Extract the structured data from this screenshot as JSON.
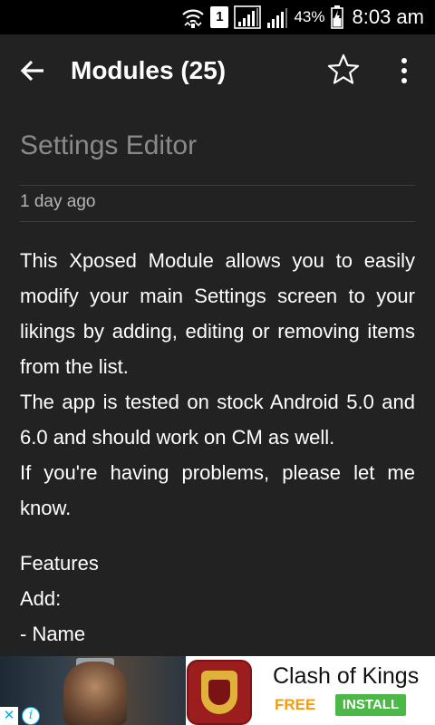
{
  "status_bar": {
    "sim_slot": "1",
    "battery_percent": "43%",
    "time": "8:03 am",
    "icons": [
      "wifi-icon",
      "sim-icon",
      "signal-icon",
      "signal-icon",
      "battery-icon"
    ]
  },
  "toolbar": {
    "title": "Modules (25)",
    "icons": [
      "back-arrow-icon",
      "star-outline-icon",
      "more-vert-icon"
    ]
  },
  "module": {
    "name": "Settings Editor",
    "updated": "1 day ago",
    "description": [
      "This Xposed Module allows you to easily modify your main Settings screen to your likings by adding, editing or removing items from the list.",
      "The app is tested on stock Android 5.0 and 6.0 and should work on CM as well.",
      "If you're having problems, please let me know."
    ],
    "features_heading": "Features",
    "features_add": "Add:",
    "features_items": [
      "- Name"
    ]
  },
  "ad": {
    "title": "Clash of Kings",
    "price": "FREE",
    "install_label": "INSTALL",
    "close_glyph": "✕",
    "info_glyph": "i",
    "colors": {
      "free": "#f39c12",
      "install_bg": "#4cb848",
      "adchoices": "#00aeef"
    }
  },
  "colors": {
    "background": "#222222",
    "status_bar": "#000000",
    "module_name": "#8a8a8a",
    "date": "#b5b5b5",
    "text": "#ffffff"
  }
}
